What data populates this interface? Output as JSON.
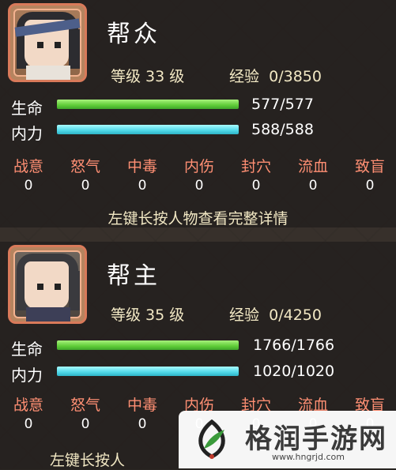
{
  "characters": [
    {
      "name": "帮众",
      "level_text": "等级 33 级",
      "exp_label": "经验",
      "exp_value": "0/3850",
      "hp_label": "生命",
      "hp_value": "577/577",
      "hp_fraction": 1.0,
      "mp_label": "内力",
      "mp_value": "588/588",
      "mp_fraction": 1.0,
      "statuses": [
        {
          "label": "战意",
          "value": "0"
        },
        {
          "label": "怒气",
          "value": "0"
        },
        {
          "label": "中毒",
          "value": "0"
        },
        {
          "label": "内伤",
          "value": "0"
        },
        {
          "label": "封穴",
          "value": "0"
        },
        {
          "label": "流血",
          "value": "0"
        },
        {
          "label": "致盲",
          "value": "0"
        }
      ],
      "hint": "左键长按人物查看完整详情"
    },
    {
      "name": "帮主",
      "level_text": "等级 35 级",
      "exp_label": "经验",
      "exp_value": "0/4250",
      "hp_label": "生命",
      "hp_value": "1766/1766",
      "hp_fraction": 1.0,
      "mp_label": "内力",
      "mp_value": "1020/1020",
      "mp_fraction": 1.0,
      "statuses": [
        {
          "label": "战意",
          "value": "0"
        },
        {
          "label": "怒气",
          "value": "0"
        },
        {
          "label": "中毒",
          "value": "0"
        },
        {
          "label": "内伤",
          "value": "0"
        },
        {
          "label": "封穴",
          "value": "0"
        },
        {
          "label": "流血",
          "value": "0"
        },
        {
          "label": "致盲",
          "value": "0"
        }
      ],
      "hint": "左键长按人"
    }
  ],
  "watermark": {
    "title": "格润手游网",
    "url": "www.hngrjd.com"
  },
  "colors": {
    "hp_bar": "#5fcc38",
    "mp_bar": "#4fd8e8",
    "status_label": "#ff8f73",
    "portrait_border": "#d97a5a"
  }
}
